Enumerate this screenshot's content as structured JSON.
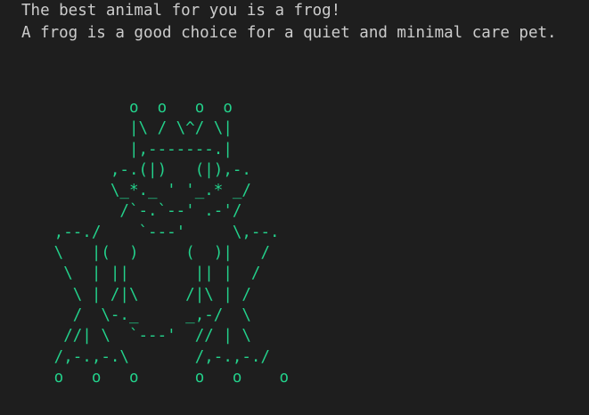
{
  "terminal": {
    "lines": [
      "The best animal for you is a frog!",
      "A frog is a good choice for a quiet and minimal care pet."
    ],
    "ascii_art": "             o  o   o  o\n             |\\ / \\^/ \\|\n             |,-------.|\n           ,-.(|)   (|),-.\n           \\_*._ ' '_.* _/\n            /`-.`--' .-'/\n     ,--./    `---'     \\,--.\n     \\   |(  )     (  )|   /\n      \\  | ||       || |  /\n       \\ | /|\\     /|\\ | /\n       /  \\-._     _,-/  \\\n      //| \\  `---'  // | \\\n     /,-.,-.\\       /,-.,-./\n     o   o   o      o   o    o",
    "colors": {
      "background": "#1e1e1e",
      "text": "#cccccc",
      "art": "#23d18b"
    }
  }
}
